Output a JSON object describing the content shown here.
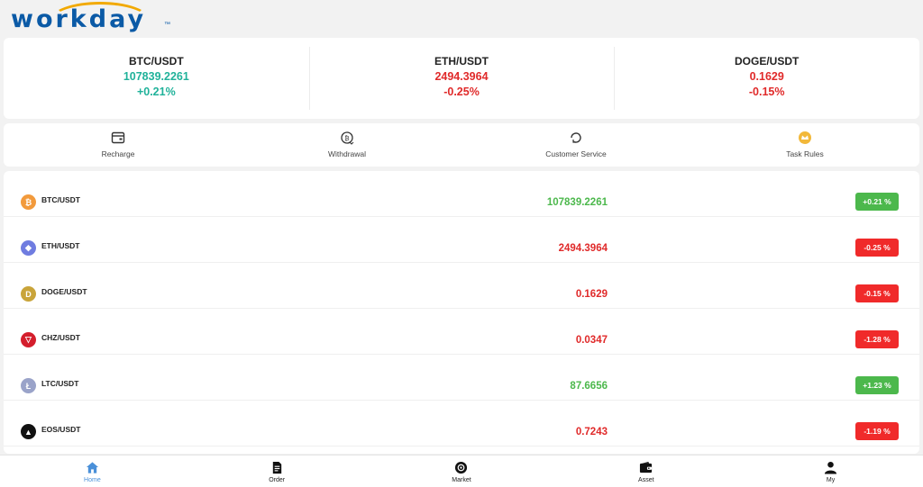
{
  "brand": {
    "logo_text": "workday",
    "tm": "™"
  },
  "ticker": [
    {
      "pair": "BTC/USDT",
      "price": "107839.2261",
      "change": "+0.21%",
      "trend": "up"
    },
    {
      "pair": "ETH/USDT",
      "price": "2494.3964",
      "change": "-0.25%",
      "trend": "down"
    },
    {
      "pair": "DOGE/USDT",
      "price": "0.1629",
      "change": "-0.15%",
      "trend": "down"
    }
  ],
  "actions": [
    {
      "label": "Recharge",
      "icon": "wallet-card-icon"
    },
    {
      "label": "Withdrawal",
      "icon": "bitcoin-withdraw-icon"
    },
    {
      "label": "Customer Service",
      "icon": "headset-refresh-icon"
    },
    {
      "label": "Task Rules",
      "icon": "crown-badge-icon"
    }
  ],
  "markets": [
    {
      "pair": "BTC/USDT",
      "price": "107839.2261",
      "change": "+0.21 %",
      "trend": "up",
      "icon": "btc-coin-icon",
      "color": "#f29a3c",
      "glyph": "₿"
    },
    {
      "pair": "ETH/USDT",
      "price": "2494.3964",
      "change": "-0.25 %",
      "trend": "down",
      "icon": "eth-coin-icon",
      "color": "#6f7ce0",
      "glyph": "◆"
    },
    {
      "pair": "DOGE/USDT",
      "price": "0.1629",
      "change": "-0.15 %",
      "trend": "down",
      "icon": "doge-coin-icon",
      "color": "#c9a43a",
      "glyph": "D"
    },
    {
      "pair": "CHZ/USDT",
      "price": "0.0347",
      "change": "-1.28 %",
      "trend": "down",
      "icon": "chz-coin-icon",
      "color": "#d41e2c",
      "glyph": "▽"
    },
    {
      "pair": "LTC/USDT",
      "price": "87.6656",
      "change": "+1.23 %",
      "trend": "up",
      "icon": "ltc-coin-icon",
      "color": "#9aa3c9",
      "glyph": "Ł"
    },
    {
      "pair": "EOS/USDT",
      "price": "0.7243",
      "change": "-1.19 %",
      "trend": "down",
      "icon": "eos-coin-icon",
      "color": "#111111",
      "glyph": "▲"
    }
  ],
  "nav": [
    {
      "label": "Home",
      "icon": "home-icon",
      "active": true
    },
    {
      "label": "Order",
      "icon": "order-document-icon",
      "active": false
    },
    {
      "label": "Market",
      "icon": "market-chart-icon",
      "active": false
    },
    {
      "label": "Asset",
      "icon": "wallet-icon",
      "active": false
    },
    {
      "label": "My",
      "icon": "user-icon",
      "active": false
    }
  ],
  "colors": {
    "up": "#20b29a",
    "down": "#e02a2a",
    "badge_up": "#4cb84c",
    "badge_down": "#f02a2a",
    "nav_active": "#4a90d9",
    "brand": "#0b5aa6",
    "brand_arc": "#f2a900"
  }
}
